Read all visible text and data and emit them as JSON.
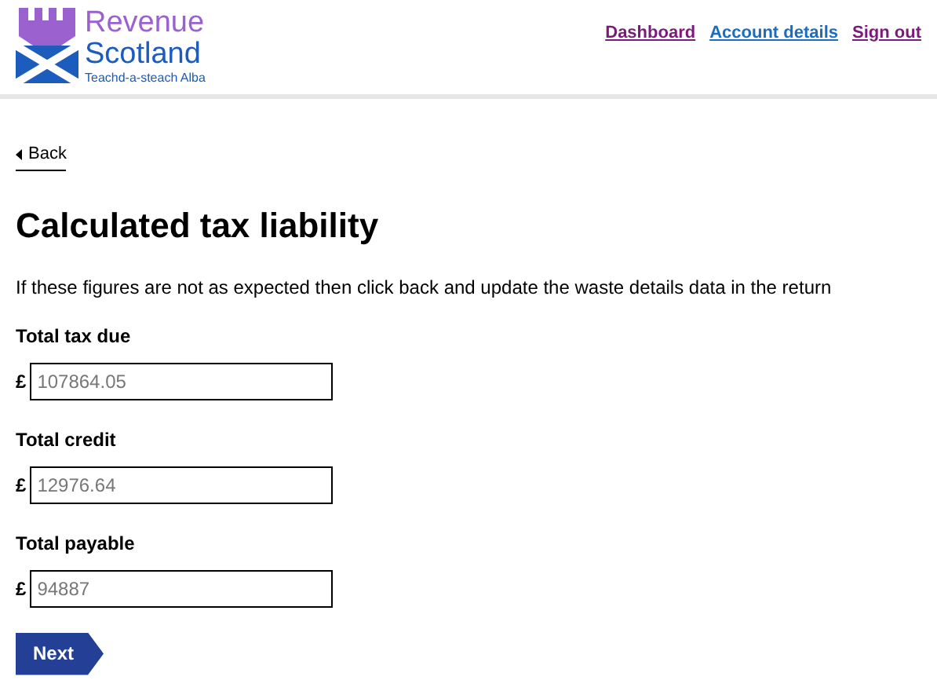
{
  "logo": {
    "name_line_1": "Revenue",
    "name_line_2": "Scotland",
    "tagline": "Teachd-a-steach Alba"
  },
  "nav_links": [
    {
      "label": "Dashboard",
      "visited": true
    },
    {
      "label": "Account details",
      "visited": false
    },
    {
      "label": "Sign out",
      "visited": true
    }
  ],
  "back_link": "Back",
  "heading": "Calculated tax liability",
  "intro": "If these figures are not as expected then click back and update the waste details data in the return",
  "fields": [
    {
      "label": "Total tax due",
      "currency": "£",
      "value": "107864.05"
    },
    {
      "label": "Total credit",
      "currency": "£",
      "value": "12976.64"
    },
    {
      "label": "Total payable",
      "currency": "£",
      "value": "94887"
    }
  ],
  "next_button": "Next"
}
